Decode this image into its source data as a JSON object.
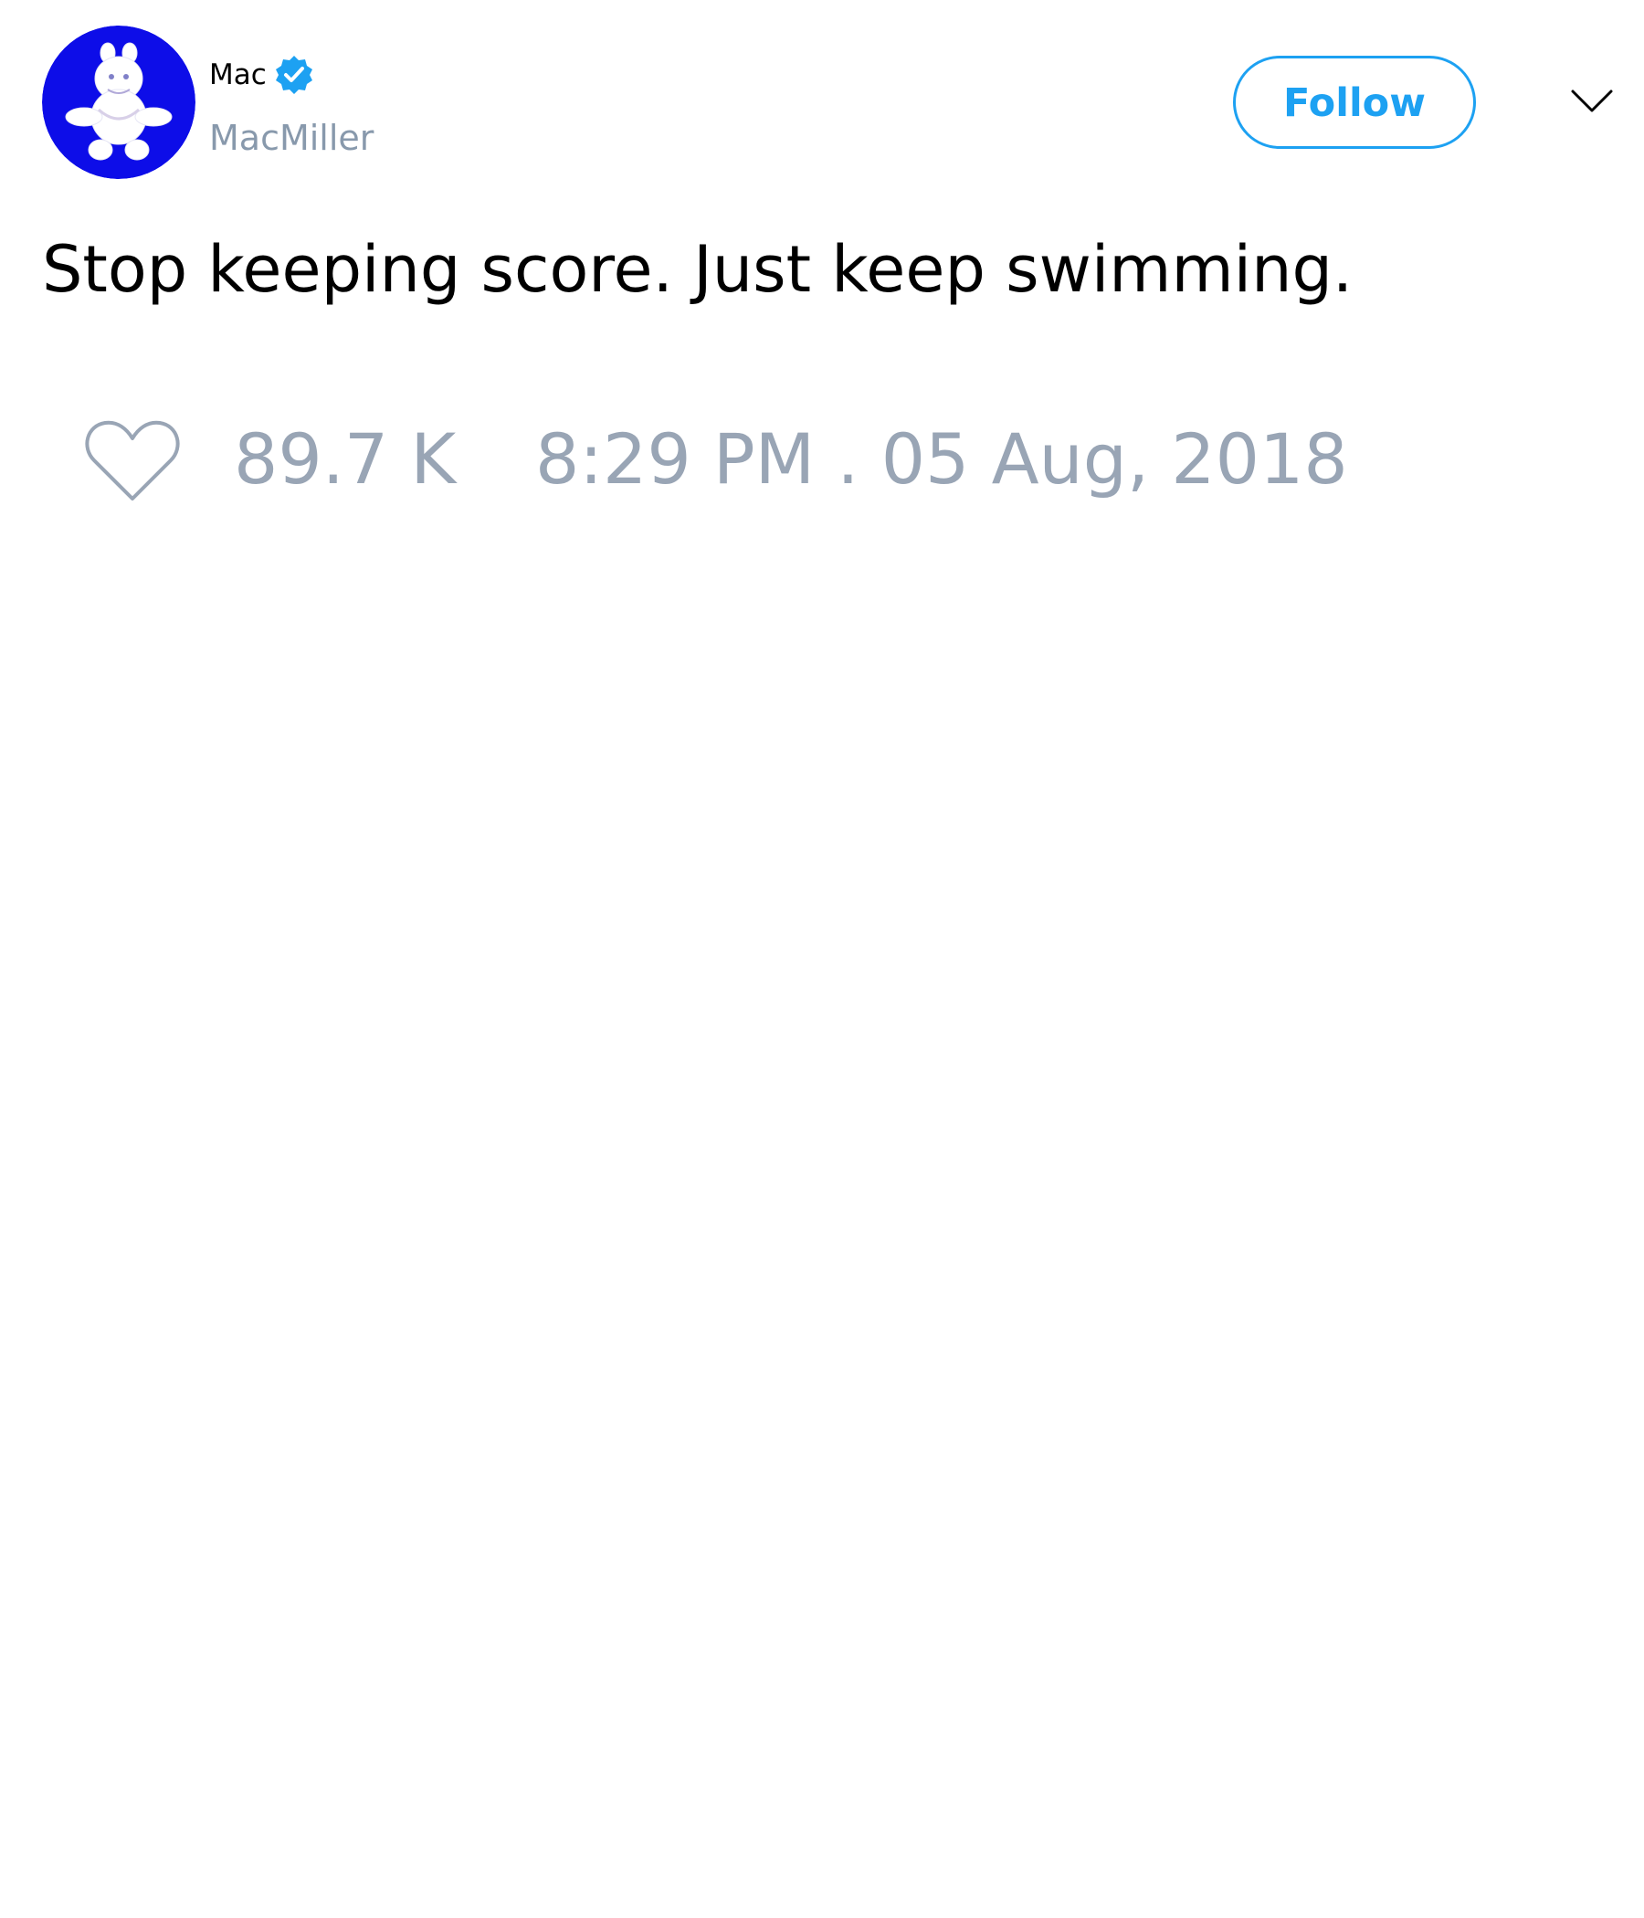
{
  "author": {
    "display_name": "Mac",
    "username": "MacMiller",
    "verified": true,
    "avatar_bg_color": "#0d0de8",
    "verified_color": "#1da1f2"
  },
  "actions": {
    "follow_label": "Follow",
    "menu_icon": "chevron-down-icon"
  },
  "tweet": {
    "text": "Stop keeping score. Just keep swimming.",
    "like_icon": "heart-icon",
    "like_count": "89.7 K",
    "timestamp": "8:29 PM . 05 Aug, 2018"
  },
  "colors": {
    "accent": "#1da1f2",
    "secondary_text": "#99a5b5",
    "primary_text": "#000000"
  }
}
